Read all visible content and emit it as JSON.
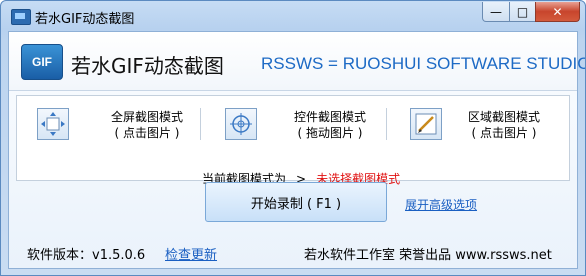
{
  "window": {
    "title": "若水GIF动态截图",
    "minimize": "—",
    "maximize": "□",
    "close": "✕"
  },
  "header": {
    "logo": "GIF",
    "app_name": "若水GIF动态截图",
    "studio": "RSSWS = RUOSHUI SOFTWARE STUDIO"
  },
  "modes": [
    {
      "icon": "fullscreen-icon",
      "label": "全屏截图模式",
      "hint": "( 点击图片 )"
    },
    {
      "icon": "crosshair-icon",
      "label": "控件截图模式",
      "hint": "( 拖动图片 )"
    },
    {
      "icon": "region-icon",
      "label": "区域截图模式",
      "hint": "( 点击图片 )"
    }
  ],
  "current_mode": {
    "label": "当前截图模式为",
    "arrow": ">",
    "value": "未选择截图模式",
    "value_color": "#e01212"
  },
  "record_button": "开始录制 ( F1 )",
  "advanced_link": "展开高级选项",
  "footer": {
    "version": "软件版本：v1.5.0.6",
    "check_update": "检查更新",
    "company": "若水软件工作室 荣誉出品 www.rssws.net"
  }
}
